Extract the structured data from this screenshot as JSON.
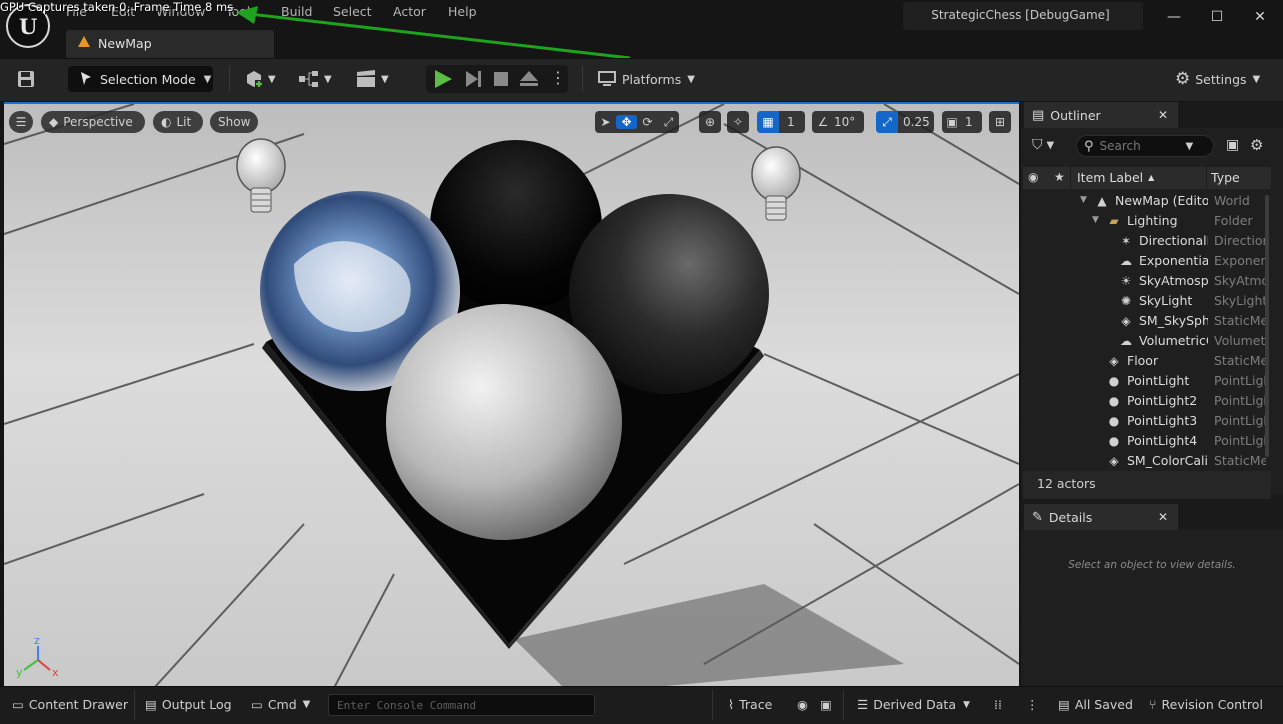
{
  "overlay": {
    "gpu_text": "GPU Captures taken 0, Frame Time 8 ms"
  },
  "menu": [
    "File",
    "Edit",
    "Window",
    "Tools",
    "Build",
    "Select",
    "Actor",
    "Help"
  ],
  "app": {
    "title": "StrategicChess [DebugGame]",
    "logo_letter": "U"
  },
  "map_tab": {
    "label": "NewMap"
  },
  "toolbar": {
    "selection_mode": "Selection Mode",
    "platforms": "Platforms",
    "settings": "Settings"
  },
  "viewport": {
    "perspective": "Perspective",
    "lit": "Lit",
    "show": "Show",
    "grid_value": "1",
    "angle_value": "10°",
    "scale_value": "0.25",
    "camera_speed": "1",
    "axis_labels": {
      "x": "x",
      "y": "y",
      "z": "z"
    }
  },
  "outliner": {
    "tab": "Outliner",
    "search_placeholder": "Search",
    "col_label": "Item Label",
    "col_type": "Type",
    "rows": [
      {
        "name": "NewMap (Editor)",
        "type": "World",
        "indent": 0,
        "icon": "map-icon"
      },
      {
        "name": "Lighting",
        "type": "Folder",
        "indent": 1,
        "icon": "folder-icon"
      },
      {
        "name": "DirectionalLight",
        "type": "DirectionalLight",
        "indent": 2,
        "icon": "directional-light-icon"
      },
      {
        "name": "ExponentialHeightFog",
        "type": "ExponentialHeightFog",
        "indent": 2,
        "icon": "fog-icon"
      },
      {
        "name": "SkyAtmosphere",
        "type": "SkyAtmosphere",
        "indent": 2,
        "icon": "sky-atmosphere-icon"
      },
      {
        "name": "SkyLight",
        "type": "SkyLight",
        "indent": 2,
        "icon": "sky-light-icon"
      },
      {
        "name": "SM_SkySphere",
        "type": "StaticMeshActor",
        "indent": 2,
        "icon": "static-mesh-icon"
      },
      {
        "name": "VolumetricCloud",
        "type": "VolumetricCloud",
        "indent": 2,
        "icon": "cloud-icon"
      },
      {
        "name": "Floor",
        "type": "StaticMeshActor",
        "indent": 1,
        "icon": "static-mesh-icon"
      },
      {
        "name": "PointLight",
        "type": "PointLight",
        "indent": 1,
        "icon": "point-light-icon"
      },
      {
        "name": "PointLight2",
        "type": "PointLight",
        "indent": 1,
        "icon": "point-light-icon"
      },
      {
        "name": "PointLight3",
        "type": "PointLight",
        "indent": 1,
        "icon": "point-light-icon"
      },
      {
        "name": "PointLight4",
        "type": "PointLight",
        "indent": 1,
        "icon": "point-light-icon"
      },
      {
        "name": "SM_ColorCalibrator",
        "type": "StaticMeshActor",
        "indent": 1,
        "icon": "static-mesh-icon"
      }
    ],
    "actor_count": "12 actors"
  },
  "details": {
    "tab": "Details",
    "empty_message": "Select an object to view details."
  },
  "statusbar": {
    "content_drawer": "Content Drawer",
    "output_log": "Output Log",
    "cmd": "Cmd",
    "console_placeholder": "Enter Console Command",
    "trace": "Trace",
    "derived_data": "Derived Data",
    "all_saved": "All Saved",
    "revision_control": "Revision Control"
  },
  "colors": {
    "accent_blue": "#1466c8",
    "play_green": "#5bbd45",
    "map_tab_orange": "#e79724"
  }
}
